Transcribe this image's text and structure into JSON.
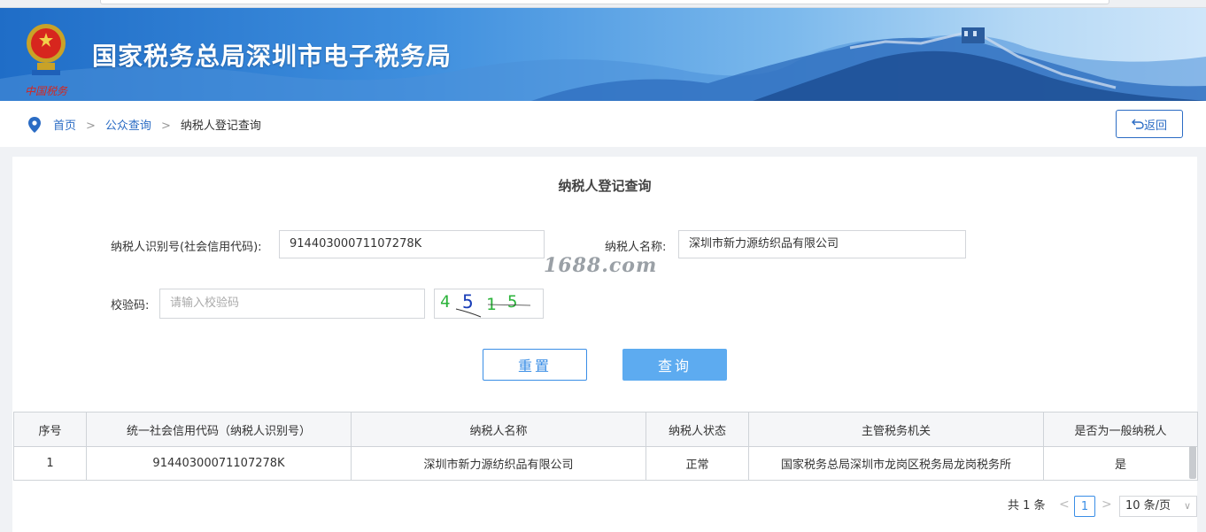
{
  "header": {
    "title": "国家税务总局深圳市电子税务局",
    "emblem_text": "中国税务"
  },
  "breadcrumb": {
    "home": "首页",
    "separator": ">",
    "public_query": "公众查询",
    "current": "纳税人登记查询"
  },
  "back_button": {
    "icon": "undo-icon",
    "label": "返回"
  },
  "form": {
    "title": "纳税人登记查询",
    "taxpayer_id_label": "纳税人识别号(社会信用代码):",
    "taxpayer_id_value": "91440300071107278K",
    "taxpayer_name_label": "纳税人名称:",
    "taxpayer_name_value": "深圳市新力源纺织品有限公司",
    "captcha_label": "校验码:",
    "captcha_placeholder": "请输入校验码",
    "captcha_chars": [
      "4",
      "5",
      "1",
      "5"
    ],
    "captcha_colors": [
      "#2bb33a",
      "#1a3fb8",
      "#2bb33a",
      "#2bb33a"
    ],
    "reset_label": "重置",
    "query_label": "查询"
  },
  "watermark": "1688.com",
  "table": {
    "headers": [
      "序号",
      "统一社会信用代码（纳税人识别号）",
      "纳税人名称",
      "纳税人状态",
      "主管税务机关",
      "是否为一般纳税人"
    ],
    "rows": [
      [
        "1",
        "91440300071107278K",
        "深圳市新力源纺织品有限公司",
        "正常",
        "国家税务总局深圳市龙岗区税务局龙岗税务所",
        "是"
      ]
    ]
  },
  "pagination": {
    "total": "共 1 条",
    "prev": "<",
    "current_page": "1",
    "next": ">",
    "page_size": "10 条/页",
    "page_size_chevron": "∨"
  },
  "colors": {
    "accent": "#2b6cc4",
    "button_blue": "#5dabf0",
    "banner_dark": "#1f6dc7"
  }
}
